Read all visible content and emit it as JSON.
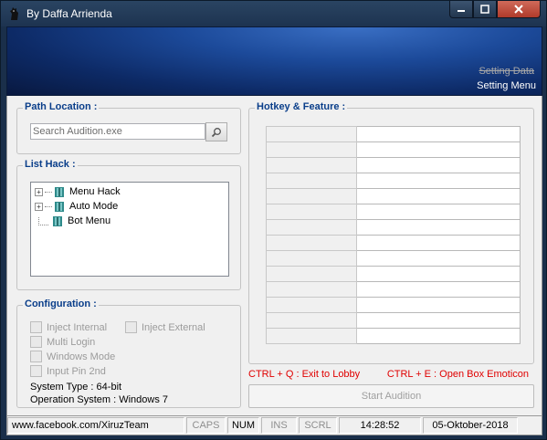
{
  "window": {
    "title": "By Daffa Arrienda",
    "min_label": "▬",
    "max_label": "▢",
    "close_label": "✕"
  },
  "banner": {
    "tab_inactive": "Setting Data",
    "tab_active": "Setting Menu"
  },
  "path_location": {
    "label": "Path Location :",
    "placeholder": "Search Audition.exe"
  },
  "list_hack": {
    "label": "List Hack :",
    "items": [
      {
        "label": "Menu Hack",
        "expandable": true
      },
      {
        "label": "Auto Mode",
        "expandable": true
      },
      {
        "label": "Bot Menu",
        "expandable": false
      }
    ]
  },
  "configuration": {
    "label": "Configuration :",
    "options": {
      "inject_internal": "Inject Internal",
      "inject_external": "Inject External",
      "multi_login": "Multi Login",
      "windows_mode": "Windows Mode",
      "input_pin": "Input Pin 2nd"
    },
    "system_type": "System Type : 64-bit",
    "operation_system": "Operation System : Windows 7"
  },
  "hotkey": {
    "label": "Hotkey & Feature :",
    "row_count": 14,
    "shortcut_left": "CTRL + Q : Exit to Lobby",
    "shortcut_right": "CTRL + E : Open Box Emoticon",
    "start_label": "Start Audition"
  },
  "statusbar": {
    "link": "www.facebook.com/XiruzTeam",
    "caps": "CAPS",
    "num": "NUM",
    "ins": "INS",
    "scrl": "SCRL",
    "time": "14:28:52",
    "date": "05-Oktober-2018"
  },
  "colors": {
    "group_label": "#0a3e8a",
    "shortcut": "#e00000",
    "close_button": "#c0463a"
  }
}
